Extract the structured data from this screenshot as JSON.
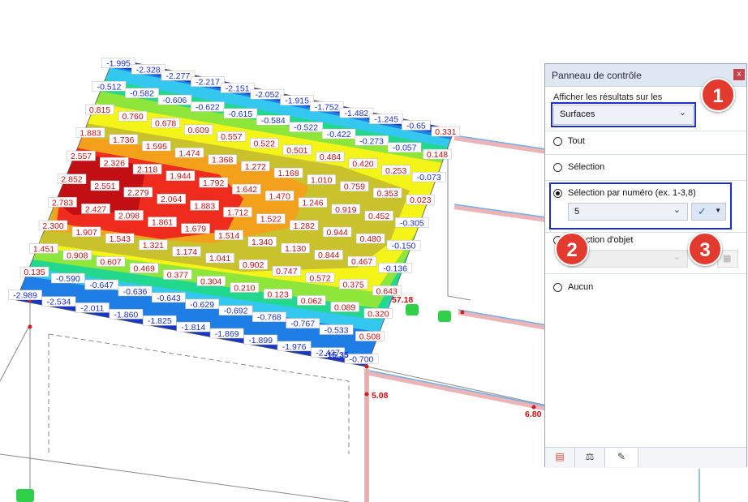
{
  "panel": {
    "title": "Panneau de contrôle",
    "close": "x",
    "section_label": "Afficher les résultats sur les",
    "surfaces_select": "Surfaces",
    "options": {
      "tout": "Tout",
      "selection": "Sélection",
      "par_numero": "Sélection par numéro (ex. 1-3,8)",
      "objet": "Sélection d'objet",
      "aucun": "Aucun"
    },
    "number_value": "5",
    "selected_option": "par_numero"
  },
  "badges": [
    "1",
    "2",
    "3"
  ],
  "colors": {
    "accent_box": "#1a2fd0",
    "badge": "#e23a2e"
  },
  "icons": [
    "results-icon",
    "balance-icon",
    "edit-display-icon",
    "check-icon",
    "pick-objects-icon"
  ],
  "model_labels": {
    "row1": [
      "-1.995",
      "-2.328",
      "-2.277",
      "-2.217",
      "-2.151",
      "-2.052",
      "-1.915",
      "-1.752",
      "-1.482",
      "-1.245",
      "-0.65",
      "0.331"
    ],
    "row2": [
      "-0.512",
      "-0.582",
      "-0.606",
      "-0.622",
      "-0.615",
      "-0.584",
      "-0.522",
      "-0.422",
      "-0.273",
      "-0.057",
      "0.148"
    ],
    "row3": [
      "0.815",
      "0.760",
      "0.678",
      "0.609",
      "0.557",
      "0.522",
      "0.501",
      "0.484",
      "0.420",
      "0.253",
      "-0.073"
    ],
    "row4": [
      "1.883",
      "1.736",
      "1.595",
      "1.474",
      "1.368",
      "1.272",
      "1.168",
      "1.010",
      "0.759",
      "0.353",
      "0.023"
    ],
    "row5": [
      "2.557",
      "2.326",
      "2.118",
      "1.944",
      "1.792",
      "1.642",
      "1.470",
      "1.246",
      "0.919",
      "0.452",
      "-0.305"
    ],
    "row6": [
      "2.852",
      "2.551",
      "2.279",
      "2.064",
      "1.883",
      "1.712",
      "1.522",
      "1.282",
      "0.944",
      "0.480",
      "-0.150"
    ],
    "row7": [
      "2.783",
      "2.427",
      "2.098",
      "1.861",
      "1.679",
      "1.514",
      "1.340",
      "1.130",
      "0.844",
      "0.467",
      "-0.136"
    ],
    "row8": [
      "2.300",
      "1.907",
      "1.543",
      "1.321",
      "1.174",
      "1.041",
      "0.902",
      "0.747",
      "0.572",
      "0.375",
      "0.643"
    ],
    "row9": [
      "1.451",
      "0.908",
      "0.607",
      "0.469",
      "0.377",
      "0.304",
      "0.210",
      "0.123",
      "0.062",
      "0.089",
      "0.320"
    ],
    "row10": [
      "0.135",
      "-0.590",
      "-0.647",
      "-0.636",
      "-0.643",
      "-0.629",
      "-0.692",
      "-0.768",
      "-0.767",
      "-0.533",
      "0.508"
    ],
    "row11": [
      "-2.989",
      "-2.534",
      "-2.011",
      "-1.860",
      "-1.825",
      "-1.814",
      "-1.869",
      "-1.899",
      "-1.976",
      "-2.427",
      "-0.700"
    ],
    "extra": [
      "57.18",
      "5.08",
      "6.80",
      "-15.35"
    ]
  }
}
